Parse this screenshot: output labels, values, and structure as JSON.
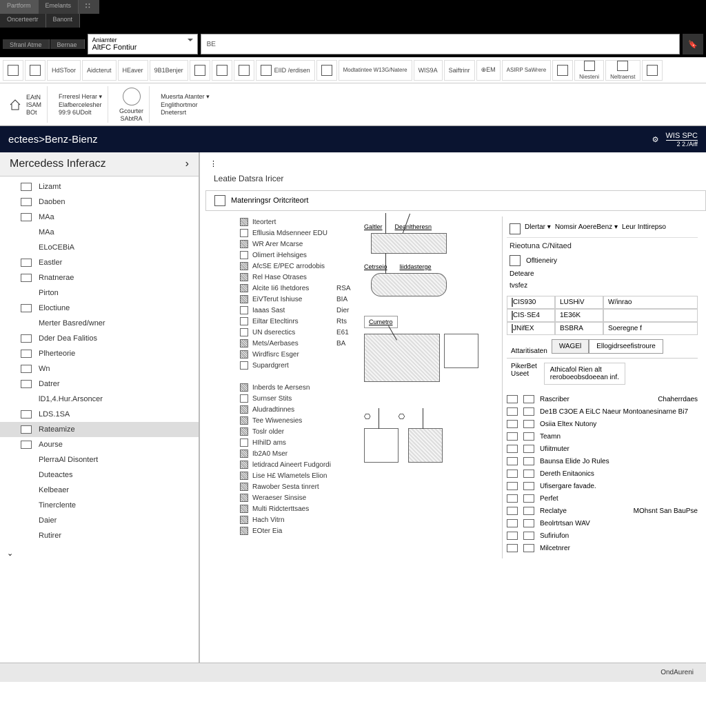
{
  "titlebar": {
    "tabs": [
      "Partform",
      "Emelants"
    ],
    "row2": [
      "Oncerteertr",
      "Banont"
    ],
    "row3": [
      "Sfranl Atme",
      "Bernae"
    ]
  },
  "url": {
    "dropdown_line1": "Aniamter",
    "dropdown_line2": "AltFC Fontiur",
    "field": "BE"
  },
  "toolbar": [
    {
      "label": "HdSToor"
    },
    {
      "label": "Aidcterut"
    },
    {
      "label": "HEaver"
    },
    {
      "label": "9B1Benjer"
    },
    {
      "label": ""
    },
    {
      "label": ""
    },
    {
      "label": ""
    },
    {
      "label": "EIID /erdisen"
    },
    {
      "label": ""
    },
    {
      "label": "Modtatintee W13G/Natere"
    },
    {
      "label": "WIS9A"
    },
    {
      "label": "Saiftrinr"
    },
    {
      "label": "⊕EM"
    },
    {
      "label": "ASIRP SaWrere"
    },
    {
      "label": ""
    },
    {
      "label": "Niesteni"
    },
    {
      "label": "Neltraenst"
    },
    {
      "label": ""
    }
  ],
  "ribbon": {
    "groups": [
      {
        "icon": "home",
        "lines": [
          "EAtN",
          "ISAM",
          "BOt"
        ]
      },
      {
        "lines": [
          "Frreresl Herar ▾",
          "Elafbercelesher",
          "99:9 6UDolt"
        ]
      },
      {
        "icon": "gauge",
        "lines": [
          "Gcourter",
          "SAbtRA"
        ]
      },
      {
        "lines": [
          "Muesrta Atanter ▾",
          "Englithortmor",
          "Dnetersrt"
        ]
      }
    ]
  },
  "brand": {
    "title": "ectees>Benz-Bienz",
    "right_label": "WIS SPC",
    "right_code": "2 2./Aiff"
  },
  "sidebar": {
    "header": "Mercedess Inferacz",
    "items": [
      {
        "label": "Lizamt",
        "icon": true
      },
      {
        "label": "Daoben",
        "icon": true
      },
      {
        "label": "MAa",
        "icon": true
      },
      {
        "label": "MAa",
        "indent": true
      },
      {
        "label": "ELoCEBiA",
        "indent": true
      },
      {
        "label": "Eastler",
        "icon": true
      },
      {
        "label": "Rnatnerae",
        "icon": true
      },
      {
        "label": "Pirton",
        "indent": true
      },
      {
        "label": "Eloctiune",
        "icon": true
      },
      {
        "label": "Merter Basred/wner",
        "indent": true
      },
      {
        "label": "Dder Dea Falitios",
        "icon": true
      },
      {
        "label": "Plherteorie",
        "icon": true
      },
      {
        "label": "Wn",
        "icon": true
      },
      {
        "label": "Datrer",
        "icon": true
      },
      {
        "label": "lD1,4.Hur.Arsoncer",
        "indent": true
      },
      {
        "label": "LDS.1SA",
        "icon": true
      },
      {
        "label": "Rateamize",
        "icon": true,
        "selected": true
      },
      {
        "label": "Aourse",
        "icon": true
      },
      {
        "label": "PlerraAl Disontert",
        "indent": true
      },
      {
        "label": "Duteactes",
        "indent": true
      },
      {
        "label": "Kelbeaer",
        "indent": true
      },
      {
        "label": "Tinerclente",
        "indent": true
      },
      {
        "label": "Daier",
        "indent": true
      },
      {
        "label": "Rutirer",
        "indent": true
      }
    ]
  },
  "content": {
    "title": "Leatie Datsra Iricer",
    "bar_label": "Matenringsr   Oritcriteort",
    "checklist1": [
      {
        "label": "Iteortert",
        "checked": true
      },
      {
        "label": "Efllusia Mdsenneer EDU",
        "checked": false
      },
      {
        "label": "WR Arer Mcarse",
        "checked": true
      },
      {
        "label": "Olimert iHehsiges",
        "checked": false
      },
      {
        "label": "AfcSE E/PEC arrodobis",
        "checked": true
      },
      {
        "label": "Rel Hase Otrases",
        "checked": true
      },
      {
        "label": "Alcite Ii6 Ihetdores",
        "checked": true,
        "code": "RSA"
      },
      {
        "label": "EiVTerut Ishiuse",
        "checked": true,
        "code": "BIA"
      },
      {
        "label": "Iaaas Sast",
        "checked": false,
        "code": "Dier"
      },
      {
        "label": "Eiltar Etecltinrs",
        "checked": false,
        "code": "Rts"
      },
      {
        "label": "UN dserectics",
        "checked": false,
        "code": "E61"
      },
      {
        "label": "Mets/Aerbases",
        "checked": true,
        "code": "BA"
      },
      {
        "label": "Wirdfisrc Esger",
        "checked": true
      },
      {
        "label": "Supardgrert"
      }
    ],
    "checklist2": [
      {
        "label": "Inberds te Aersesn",
        "checked": true
      },
      {
        "label": "Surnser Stits",
        "checked": false
      },
      {
        "label": "Aludradtinnes",
        "checked": true
      },
      {
        "label": "Tee Wiwenesies",
        "checked": true
      },
      {
        "label": "Toslr older",
        "checked": true
      },
      {
        "label": "HIhilD ams",
        "checked": false
      },
      {
        "label": "Ib2A0 Mser",
        "checked": true
      },
      {
        "label": "letidracd Aineert Fudgordi",
        "checked": true
      },
      {
        "label": "Lise H£ Wlametels Elion",
        "checked": true
      },
      {
        "label": "Rawober Sesta tinrert",
        "checked": true
      },
      {
        "label": "Weraeser Sinsise",
        "checked": true
      },
      {
        "label": "Multi Ridcterttsaes",
        "checked": true
      },
      {
        "label": "Hach Vitrn",
        "checked": true
      },
      {
        "label": "EOter Eia",
        "checked": true
      }
    ],
    "diagrams": {
      "label1a": "Galtler",
      "label1b": "Deanltheresn",
      "label2a": "Cetrseio",
      "label2b": "liiddasterge",
      "label3": "Cumetro"
    }
  },
  "right": {
    "header": [
      "Dlertar ▾",
      "Nomsir AoereBenz ▾",
      "Leur Inttirepso"
    ],
    "section1_title": "Rieotuna C/Nitaed",
    "section1_items": [
      "Ofltieneiry",
      "Deteare",
      "tvsfez"
    ],
    "grid": [
      [
        "CIS930",
        "LUSHiV",
        "W/inrao"
      ],
      [
        "CIS·SE4",
        "1E36K",
        ""
      ],
      [
        "JNifEX",
        "BSBRA",
        "Soeregne f"
      ]
    ],
    "tabs_left": "Attaritisaten",
    "tabs": [
      "WAGEl",
      "Ellogidrseefistroure"
    ],
    "footer_left": [
      "PikerBet",
      "Useet"
    ],
    "footer_right": [
      "Athicafol Rien alt",
      "reroboeobsdoeean inf."
    ],
    "list": [
      "Rascriber",
      "De1B C3OE A EiLC Naeur Montoanesinarne Bi7",
      "Osiia Eltex Nutony",
      "Teamn",
      "Ufiitmuter",
      "Baunsa Elide Jo Rules",
      "Dereth Enitaonics",
      "Ufisergare favade.",
      "Perfet",
      "Reclatye",
      "Beolrtrtsan WAV",
      "Sufiriufon",
      "Milcetnrer"
    ],
    "list_right": [
      "Chaherrdaes",
      "",
      "",
      "",
      "",
      "",
      "",
      "",
      "",
      "MOhsnt San BauPse"
    ]
  },
  "footer": "OndAureni"
}
